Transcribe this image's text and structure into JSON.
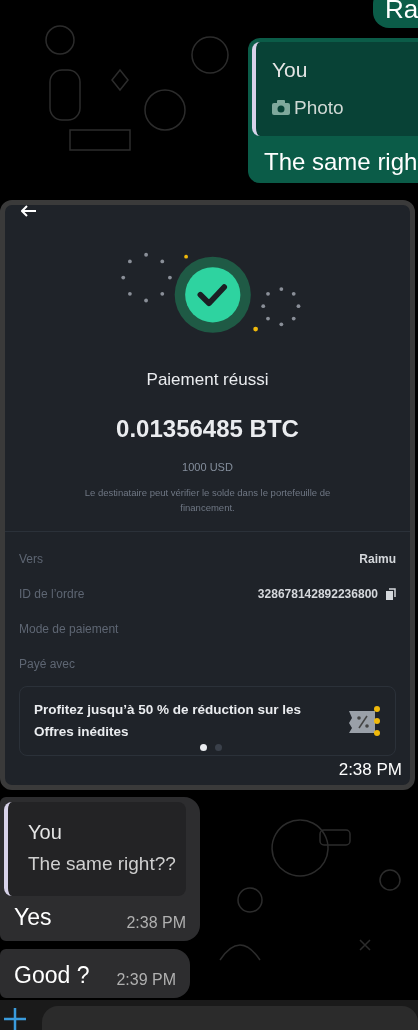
{
  "top_message": {
    "text": "Ra"
  },
  "reply_message": {
    "quote": {
      "author": "You",
      "media": "Photo"
    },
    "text": "The same righ"
  },
  "image_message": {
    "time": "2:38 PM",
    "screenshot": {
      "title": "Paiement réussi",
      "amount": "0.01356485 BTC",
      "fiat": "1000 USD",
      "note": "Le destinataire peut vérifier le solde dans le portefeuille de financement.",
      "details": [
        {
          "kind": "plain",
          "label": "Vers",
          "value": "Raimu"
        },
        {
          "kind": "copyable",
          "label": "ID de l’ordre",
          "value": "328678142892236800"
        },
        {
          "kind": "plain",
          "label": "Mode de paiement"
        },
        {
          "kind": "plain",
          "label": "Payé avec"
        }
      ],
      "promo": {
        "text": "Profitez jusqu’à 50 % de réduction sur les Offres inédites"
      },
      "pager": [
        {
          "selected": true
        },
        {
          "selected": false
        }
      ]
    }
  },
  "incoming": [
    {
      "quote": {
        "author": "You",
        "text": "The same right??"
      },
      "text": "Yes",
      "time": "2:38 PM"
    },
    {
      "text": "Good ?",
      "time": "2:39 PM"
    }
  ]
}
